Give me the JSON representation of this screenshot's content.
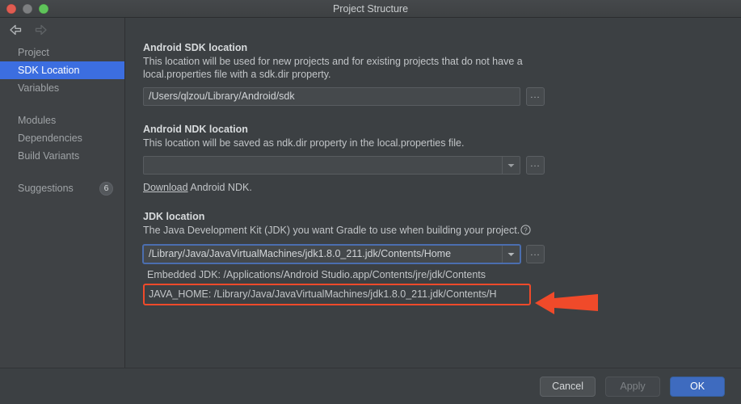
{
  "window": {
    "title": "Project Structure",
    "traffic_lights": [
      "close-red",
      "minimize-gray",
      "zoom-green"
    ]
  },
  "nav": {
    "back_icon": "arrow-left-icon",
    "forward_icon": "arrow-right-icon"
  },
  "sidebar": {
    "groups": [
      {
        "items": [
          {
            "label": "Project",
            "selected": false
          },
          {
            "label": "SDK Location",
            "selected": true
          },
          {
            "label": "Variables",
            "selected": false
          }
        ]
      },
      {
        "items": [
          {
            "label": "Modules",
            "selected": false
          },
          {
            "label": "Dependencies",
            "selected": false
          },
          {
            "label": "Build Variants",
            "selected": false
          }
        ]
      },
      {
        "items": [
          {
            "label": "Suggestions",
            "selected": false,
            "badge": "6"
          }
        ]
      }
    ]
  },
  "sections": {
    "sdk": {
      "title": "Android SDK location",
      "description": "This location will be used for new projects and for existing projects that do not have a local.properties file with a sdk.dir property.",
      "value": "/Users/qlzou/Library/Android/sdk",
      "browse_label": "..."
    },
    "ndk": {
      "title": "Android NDK location",
      "description": "This location will be saved as ndk.dir property in the local.properties file.",
      "value": "",
      "browse_label": "...",
      "download_link": "Download",
      "download_rest": " Android NDK."
    },
    "jdk": {
      "title": "JDK location",
      "description": "The Java Development Kit (JDK) you want Gradle to use when building your project.",
      "help_icon": "help-circle-icon",
      "value": "/Library/Java/JavaVirtualMachines/jdk1.8.0_211.jdk/Contents/Home",
      "browse_label": "...",
      "embedded_jdk": "Embedded JDK: /Applications/Android Studio.app/Contents/jre/jdk/Contents",
      "java_home": "JAVA_HOME: /Library/Java/JavaVirtualMachines/jdk1.8.0_211.jdk/Contents/H"
    }
  },
  "annotation": {
    "arrow_icon": "red-left-arrow-annotation",
    "color": "#f04a2a"
  },
  "footer": {
    "cancel": "Cancel",
    "apply": "Apply",
    "ok": "OK"
  },
  "colors": {
    "accent_blue": "#3c6ee0",
    "primary_button": "#3e6bbf",
    "annotation_red": "#f04a2a",
    "window_bg": "#3c4043",
    "sidebar_bg": "#3f4245"
  }
}
